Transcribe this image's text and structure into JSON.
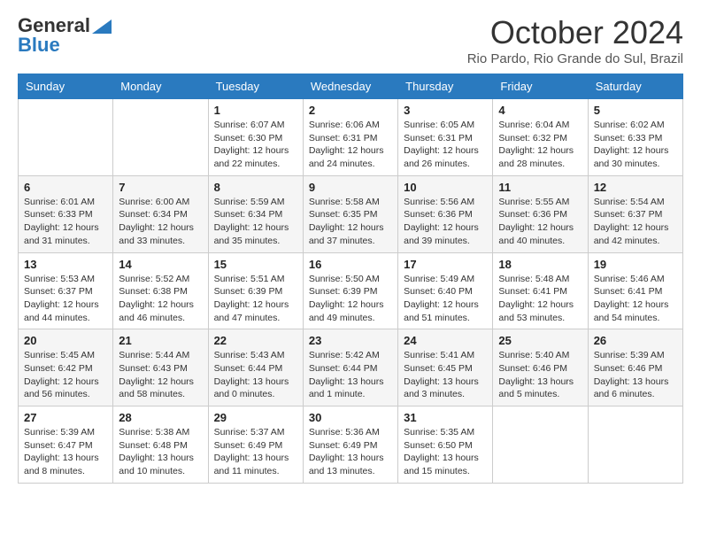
{
  "header": {
    "logo_general": "General",
    "logo_blue": "Blue",
    "month_title": "October 2024",
    "subtitle": "Rio Pardo, Rio Grande do Sul, Brazil"
  },
  "weekdays": [
    "Sunday",
    "Monday",
    "Tuesday",
    "Wednesday",
    "Thursday",
    "Friday",
    "Saturday"
  ],
  "weeks": [
    [
      {
        "day": "",
        "text": ""
      },
      {
        "day": "",
        "text": ""
      },
      {
        "day": "1",
        "text": "Sunrise: 6:07 AM\nSunset: 6:30 PM\nDaylight: 12 hours and 22 minutes."
      },
      {
        "day": "2",
        "text": "Sunrise: 6:06 AM\nSunset: 6:31 PM\nDaylight: 12 hours and 24 minutes."
      },
      {
        "day": "3",
        "text": "Sunrise: 6:05 AM\nSunset: 6:31 PM\nDaylight: 12 hours and 26 minutes."
      },
      {
        "day": "4",
        "text": "Sunrise: 6:04 AM\nSunset: 6:32 PM\nDaylight: 12 hours and 28 minutes."
      },
      {
        "day": "5",
        "text": "Sunrise: 6:02 AM\nSunset: 6:33 PM\nDaylight: 12 hours and 30 minutes."
      }
    ],
    [
      {
        "day": "6",
        "text": "Sunrise: 6:01 AM\nSunset: 6:33 PM\nDaylight: 12 hours and 31 minutes."
      },
      {
        "day": "7",
        "text": "Sunrise: 6:00 AM\nSunset: 6:34 PM\nDaylight: 12 hours and 33 minutes."
      },
      {
        "day": "8",
        "text": "Sunrise: 5:59 AM\nSunset: 6:34 PM\nDaylight: 12 hours and 35 minutes."
      },
      {
        "day": "9",
        "text": "Sunrise: 5:58 AM\nSunset: 6:35 PM\nDaylight: 12 hours and 37 minutes."
      },
      {
        "day": "10",
        "text": "Sunrise: 5:56 AM\nSunset: 6:36 PM\nDaylight: 12 hours and 39 minutes."
      },
      {
        "day": "11",
        "text": "Sunrise: 5:55 AM\nSunset: 6:36 PM\nDaylight: 12 hours and 40 minutes."
      },
      {
        "day": "12",
        "text": "Sunrise: 5:54 AM\nSunset: 6:37 PM\nDaylight: 12 hours and 42 minutes."
      }
    ],
    [
      {
        "day": "13",
        "text": "Sunrise: 5:53 AM\nSunset: 6:37 PM\nDaylight: 12 hours and 44 minutes."
      },
      {
        "day": "14",
        "text": "Sunrise: 5:52 AM\nSunset: 6:38 PM\nDaylight: 12 hours and 46 minutes."
      },
      {
        "day": "15",
        "text": "Sunrise: 5:51 AM\nSunset: 6:39 PM\nDaylight: 12 hours and 47 minutes."
      },
      {
        "day": "16",
        "text": "Sunrise: 5:50 AM\nSunset: 6:39 PM\nDaylight: 12 hours and 49 minutes."
      },
      {
        "day": "17",
        "text": "Sunrise: 5:49 AM\nSunset: 6:40 PM\nDaylight: 12 hours and 51 minutes."
      },
      {
        "day": "18",
        "text": "Sunrise: 5:48 AM\nSunset: 6:41 PM\nDaylight: 12 hours and 53 minutes."
      },
      {
        "day": "19",
        "text": "Sunrise: 5:46 AM\nSunset: 6:41 PM\nDaylight: 12 hours and 54 minutes."
      }
    ],
    [
      {
        "day": "20",
        "text": "Sunrise: 5:45 AM\nSunset: 6:42 PM\nDaylight: 12 hours and 56 minutes."
      },
      {
        "day": "21",
        "text": "Sunrise: 5:44 AM\nSunset: 6:43 PM\nDaylight: 12 hours and 58 minutes."
      },
      {
        "day": "22",
        "text": "Sunrise: 5:43 AM\nSunset: 6:44 PM\nDaylight: 13 hours and 0 minutes."
      },
      {
        "day": "23",
        "text": "Sunrise: 5:42 AM\nSunset: 6:44 PM\nDaylight: 13 hours and 1 minute."
      },
      {
        "day": "24",
        "text": "Sunrise: 5:41 AM\nSunset: 6:45 PM\nDaylight: 13 hours and 3 minutes."
      },
      {
        "day": "25",
        "text": "Sunrise: 5:40 AM\nSunset: 6:46 PM\nDaylight: 13 hours and 5 minutes."
      },
      {
        "day": "26",
        "text": "Sunrise: 5:39 AM\nSunset: 6:46 PM\nDaylight: 13 hours and 6 minutes."
      }
    ],
    [
      {
        "day": "27",
        "text": "Sunrise: 5:39 AM\nSunset: 6:47 PM\nDaylight: 13 hours and 8 minutes."
      },
      {
        "day": "28",
        "text": "Sunrise: 5:38 AM\nSunset: 6:48 PM\nDaylight: 13 hours and 10 minutes."
      },
      {
        "day": "29",
        "text": "Sunrise: 5:37 AM\nSunset: 6:49 PM\nDaylight: 13 hours and 11 minutes."
      },
      {
        "day": "30",
        "text": "Sunrise: 5:36 AM\nSunset: 6:49 PM\nDaylight: 13 hours and 13 minutes."
      },
      {
        "day": "31",
        "text": "Sunrise: 5:35 AM\nSunset: 6:50 PM\nDaylight: 13 hours and 15 minutes."
      },
      {
        "day": "",
        "text": ""
      },
      {
        "day": "",
        "text": ""
      }
    ]
  ]
}
